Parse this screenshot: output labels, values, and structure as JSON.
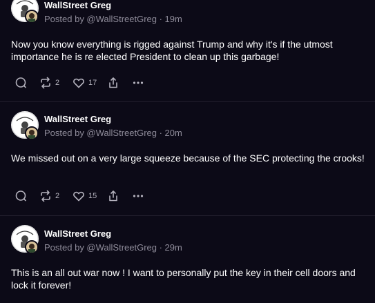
{
  "colors": {
    "background": "#0c0a17",
    "divider": "#23202f",
    "text": "#ffffff",
    "muted": "#8e8b99",
    "icon": "#b4b2bd"
  },
  "posts": [
    {
      "author": "WallStreet Greg",
      "meta": "Posted by @WallStreetGreg · 19m",
      "body": "Now you know everything is rigged against Trump and why it's if the utmost importance he is re elected President to clean up this garbage!",
      "reposts": "2",
      "likes": "17"
    },
    {
      "author": "WallStreet Greg",
      "meta": "Posted by @WallStreetGreg · 20m",
      "body": "We missed out on a very large squeeze because of the SEC protecting the crooks!",
      "reposts": "2",
      "likes": "15"
    },
    {
      "author": "WallStreet Greg",
      "meta": "Posted by @WallStreetGreg · 29m",
      "body": "This is an all out war now ! I want to personally put the key in their cell doors and lock it forever!",
      "reposts": "",
      "likes": ""
    }
  ],
  "icons": {
    "reply": "reply-icon",
    "repost": "repost-icon",
    "like": "heart-icon",
    "share": "share-icon",
    "more": "more-icon"
  }
}
